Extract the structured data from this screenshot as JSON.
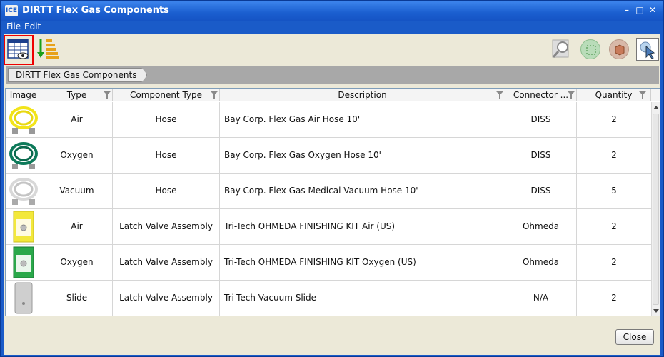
{
  "window": {
    "title": "DIRTT Flex Gas Components",
    "app_icon_text": "ICE"
  },
  "menu": {
    "items": [
      "File",
      "Edit"
    ]
  },
  "breadcrumb": {
    "label": "DIRTT Flex Gas Components"
  },
  "table": {
    "headers": [
      "Image",
      "Type",
      "Component Type",
      "Description",
      "Connector ...",
      "Quantity"
    ],
    "rows": [
      {
        "image": "yellow-hose",
        "type": "Air",
        "component_type": "Hose",
        "description": "Bay Corp. Flex Gas Air Hose 10'",
        "connector": "DISS",
        "quantity": "2"
      },
      {
        "image": "green-hose",
        "type": "Oxygen",
        "component_type": "Hose",
        "description": "Bay Corp. Flex Gas Oxygen Hose 10'",
        "connector": "DISS",
        "quantity": "2"
      },
      {
        "image": "white-hose",
        "type": "Vacuum",
        "component_type": "Hose",
        "description": "Bay Corp. Flex Gas Medical Vacuum Hose 10'",
        "connector": "DISS",
        "quantity": "5"
      },
      {
        "image": "medical-air-valve",
        "type": "Air",
        "component_type": "Latch Valve Assembly",
        "description": "Tri-Tech OHMEDA FINISHING KIT Air (US)",
        "connector": "Ohmeda",
        "quantity": "2"
      },
      {
        "image": "oxygen-valve",
        "type": "Oxygen",
        "component_type": "Latch Valve Assembly",
        "description": "Tri-Tech OHMEDA FINISHING KIT Oxygen (US)",
        "connector": "Ohmeda",
        "quantity": "2"
      },
      {
        "image": "vacuum-slide",
        "type": "Slide",
        "component_type": "Latch Valve Assembly",
        "description": "Tri-Tech Vacuum Slide",
        "connector": "N/A",
        "quantity": "2"
      }
    ]
  },
  "footer": {
    "close_label": "Close"
  },
  "colors": {
    "titlebar": "#1b5fd0",
    "selection_border": "#ee0000",
    "background": "#ece9d8"
  }
}
